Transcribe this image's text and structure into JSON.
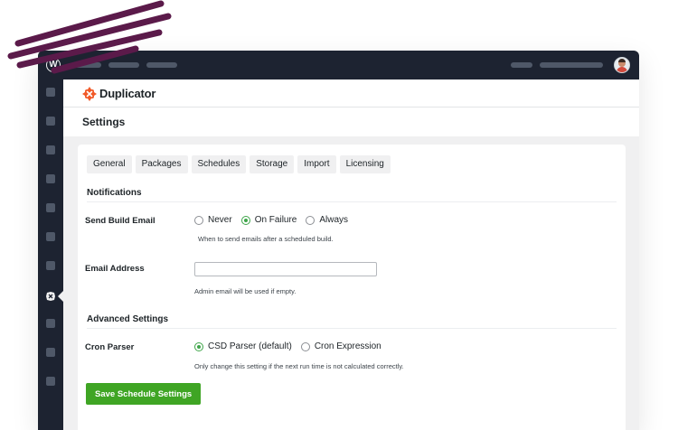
{
  "colors": {
    "admin_bar": "#1d2331",
    "accent_green": "#3fa524",
    "brand_orange": "#f15a29",
    "decor_stroke": "#5b1a4a"
  },
  "icons": {
    "wp_logo": "wordpress-icon",
    "brand_logo": "duplicator-logo-icon",
    "active_menu": "duplicator-menu-icon",
    "avatar": "user-avatar"
  },
  "brand": {
    "name": "Duplicator"
  },
  "page": {
    "title": "Settings"
  },
  "tabs": [
    {
      "label": "General"
    },
    {
      "label": "Packages"
    },
    {
      "label": "Schedules"
    },
    {
      "label": "Storage"
    },
    {
      "label": "Import"
    },
    {
      "label": "Licensing"
    }
  ],
  "notifications": {
    "heading": "Notifications",
    "send_build_email": {
      "label": "Send Build Email",
      "options": [
        "Never",
        "On Failure",
        "Always"
      ],
      "selected": "On Failure",
      "help": "When to send emails after a scheduled build."
    },
    "email_address": {
      "label": "Email Address",
      "value": "",
      "placeholder": "",
      "help": "Admin email will be used if empty."
    }
  },
  "advanced": {
    "heading": "Advanced Settings",
    "cron_parser": {
      "label": "Cron Parser",
      "options": [
        "CSD Parser (default)",
        "Cron Expression"
      ],
      "selected": "CSD Parser (default)",
      "help": "Only change this setting if the next run time is not calculated correctly."
    }
  },
  "actions": {
    "save_label": "Save Schedule Settings"
  }
}
